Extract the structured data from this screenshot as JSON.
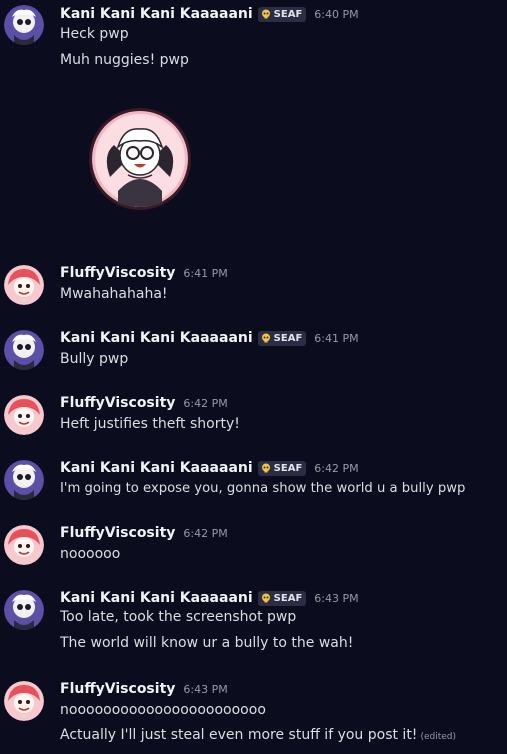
{
  "messages": [
    {
      "author": "Kani Kani Kani Kaaaaani",
      "tag": "SEAF",
      "time": "6:40 PM",
      "lines": [
        "Heck pwp",
        "Muh nuggies! pwp"
      ]
    },
    {
      "author": "FluffyViscosity",
      "time": "6:41 PM",
      "lines": [
        "Mwahahahaha!"
      ]
    },
    {
      "author": "Kani Kani Kani Kaaaaani",
      "tag": "SEAF",
      "time": "6:41 PM",
      "lines": [
        "Bully pwp"
      ]
    },
    {
      "author": "FluffyViscosity",
      "time": "6:42 PM",
      "lines": [
        "Heft justifies theft shorty!"
      ]
    },
    {
      "author": "Kani Kani Kani Kaaaaani",
      "tag": "SEAF",
      "time": "6:42 PM",
      "lines": [
        "I'm going to expose you, gonna show the world u a bully pwp"
      ]
    },
    {
      "author": "FluffyViscosity",
      "time": "6:42 PM",
      "lines": [
        "noooooo"
      ]
    },
    {
      "author": "Kani Kani Kani Kaaaaani",
      "tag": "SEAF",
      "time": "6:43 PM",
      "lines": [
        "Too late, took the screenshot pwp",
        "The world will know ur a bully to the wah!"
      ]
    },
    {
      "author": "FluffyViscosity",
      "time": "6:43 PM",
      "lines": [
        "nooooooooooooooooooooooo",
        "Actually I'll just steal even more stuff if you post it!"
      ],
      "edited": "(edited)"
    }
  ],
  "colors": {
    "background": "#0b0d1f",
    "text": "#dbdee1",
    "timestamp": "#949ba4",
    "tag_bg": "#2b2d44"
  }
}
